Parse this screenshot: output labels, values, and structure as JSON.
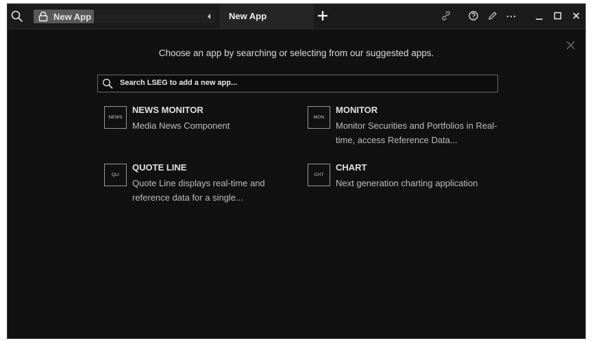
{
  "titlebar": {
    "app_pill_label": "New App",
    "tab_label": "New App"
  },
  "main": {
    "prompt": "Choose an app by searching or selecting from our suggested apps.",
    "search_placeholder": "Search LSEG to add a new app...",
    "apps": [
      {
        "badge": "NEWS",
        "name": "NEWS MONITOR",
        "description": "Media News Component"
      },
      {
        "badge": "MON",
        "name": "MONITOR",
        "description": "Monitor Securities and Portfolios in Real-time, access Reference Data..."
      },
      {
        "badge": "QLI",
        "name": "QUOTE LINE",
        "description": "Quote Line displays real-time and reference data for a single..."
      },
      {
        "badge": "CHT",
        "name": "CHART",
        "description": "Next generation charting application"
      }
    ]
  },
  "colors": {
    "background": "#111111",
    "titlebar": "#1b1b1b",
    "pill": "#595959",
    "text": "#dcdcdc"
  },
  "icons": {
    "titlebar": [
      "search-icon",
      "lock-icon",
      "collapse-arrow-icon",
      "plus-icon",
      "link-icon",
      "help-icon",
      "edit-icon",
      "more-icon",
      "minimize-icon",
      "maximize-icon",
      "close-icon"
    ],
    "panel": [
      "close-panel-icon",
      "search-icon"
    ]
  }
}
